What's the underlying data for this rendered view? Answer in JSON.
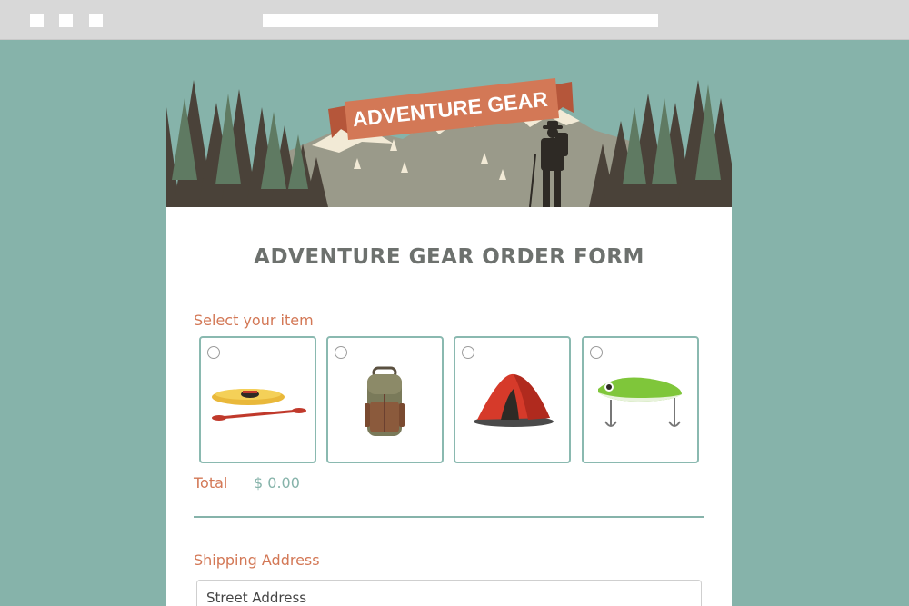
{
  "browser": {
    "address": ""
  },
  "banner": {
    "ribbon_text": "ADVENTURE GEAR"
  },
  "form": {
    "title": "ADVENTURE GEAR ORDER FORM",
    "select_label": "Select your item",
    "items": [
      {
        "name": "kayak",
        "icon": "kayak-icon"
      },
      {
        "name": "backpack",
        "icon": "backpack-icon"
      },
      {
        "name": "tent",
        "icon": "tent-icon"
      },
      {
        "name": "fishing lure",
        "icon": "fishing-lure-icon"
      }
    ],
    "total_label": "Total",
    "total_value": "$ 0.00",
    "shipping_label": "Shipping Address",
    "street_placeholder": "Street Address"
  },
  "colors": {
    "background": "#86b3aa",
    "accent": "#d37856",
    "teal": "#86b3aa",
    "forest": "#4a4239",
    "title_gray": "#6d716e"
  }
}
